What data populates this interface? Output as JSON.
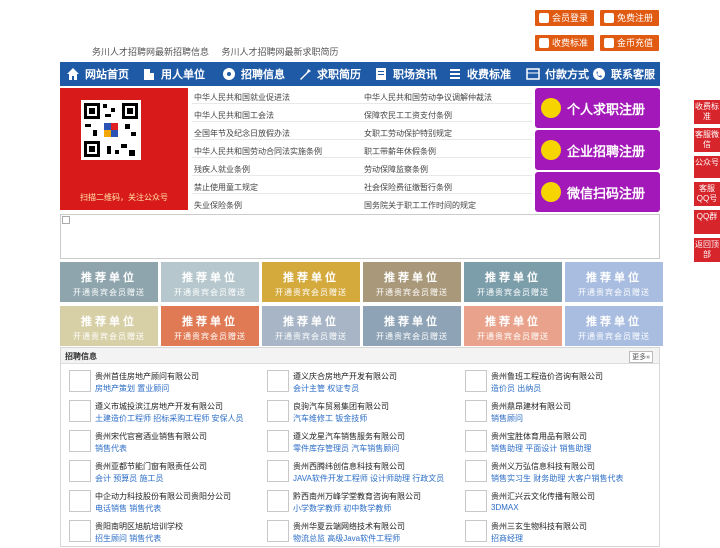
{
  "top_buttons": {
    "member_login": "会员登录",
    "free_register": "免费注册",
    "fee_standard": "收费标准",
    "coin_recharge": "金币充值"
  },
  "top_links": [
    "务川人才招聘网最新招聘信息",
    "务川人才招聘网最新求职简历"
  ],
  "nav": [
    "网站首页",
    "用人单位",
    "招聘信息",
    "求职简历",
    "职场资讯",
    "收费标准",
    "付款方式",
    "联系客服"
  ],
  "qr_caption": "扫描二维码，关注公众号",
  "laws_left": [
    "中华人民共和国就业促进法",
    "中华人民共和国工会法",
    "全国年节及纪念日放假办法",
    "中华人民共和国劳动合同法实施条例",
    "残疾人就业条例",
    "禁止使用童工规定",
    "失业保险条例"
  ],
  "laws_right": [
    "中华人民共和国劳动争议调解仲裁法",
    "保障农民工工资支付条例",
    "女职工劳动保护特别规定",
    "职工带薪年休假条例",
    "劳动保障监察条例",
    "社会保险费征缴暂行条例",
    "国务院关于职工工作时间的规定"
  ],
  "register": {
    "personal": "个人求职注册",
    "company": "企业招聘注册",
    "wechat": "微信扫码注册"
  },
  "promo": {
    "title": "推荐单位",
    "sub": "开通贵宾会员赠送"
  },
  "jobs": {
    "title": "招聘信息",
    "more": "更多»",
    "rows": [
      [
        {
          "name": "贵州首佳房地产顾问有限公司",
          "pos": "房地产策划  置业顾问"
        },
        {
          "name": "遵义庆合房地产开发有限公司",
          "pos": "会计主管  权证专员"
        },
        {
          "name": "贵州鲁班工程造价咨询有限公司",
          "pos": "造价员  出纳员"
        }
      ],
      [
        {
          "name": "遵义市城投滨江房地产开发有限公司",
          "pos": "土建造价工程师  招标采购工程师  安保人员"
        },
        {
          "name": "良驹汽车贸易集团有限公司",
          "pos": "汽车维修工  钣金技师"
        },
        {
          "name": "贵州鼎昂建材有限公司",
          "pos": "销售顾问"
        }
      ],
      [
        {
          "name": "贵州宋代官窖酒业销售有限公司",
          "pos": "销售代表"
        },
        {
          "name": "遵义龙星汽车销售服务有限公司",
          "pos": "零件库存管理员  汽车销售顾问"
        },
        {
          "name": "贵州宝胜体育用品有限公司",
          "pos": "销售助理  平面设计  销售助理"
        }
      ],
      [
        {
          "name": "贵州亚都节能门窗有限责任公司",
          "pos": "会计  预算员  施工员"
        },
        {
          "name": "贵州西腾纬创信息科技有限公司",
          "pos": "JAVA软件开发工程师  设计师助理  行政文员"
        },
        {
          "name": "贵州义万弘信息科技有限公司",
          "pos": "销售实习生  财务助理  大客户销售代表"
        }
      ],
      [
        {
          "name": "中企动力科技股份有限公司贵阳分公司",
          "pos": "电话销售  销售代表"
        },
        {
          "name": "黔西南州万峰学堂教育咨询有限公司",
          "pos": "小学数学教师  初中数学教师"
        },
        {
          "name": "贵州汇兴云文化传播有限公司",
          "pos": "3DMAX"
        }
      ],
      [
        {
          "name": "贵阳南明区旭航培训学校",
          "pos": "招生顾问  销售代表"
        },
        {
          "name": "贵州华夏云端网络技术有限公司",
          "pos": "物流总监  高级Java软件工程师"
        },
        {
          "name": "贵州三玄生物科技有限公司",
          "pos": "招商经理"
        }
      ]
    ]
  },
  "side": [
    "收费标准",
    "客服微信",
    "公众号",
    "客服QQ号",
    "QQ群",
    "返回顶部"
  ],
  "colors": {
    "nav": "#1f5aa6",
    "accent": "#e05a12",
    "purple": "#a318b8",
    "side": "#d6252b",
    "link": "#2b6dc6"
  }
}
